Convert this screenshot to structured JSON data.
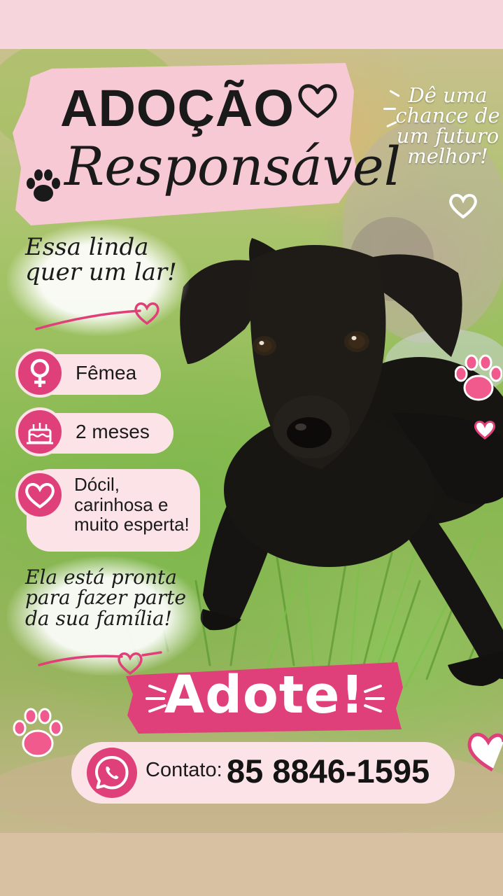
{
  "title": {
    "line1": "ADOÇÃO",
    "line2": "Responsável"
  },
  "tagline": "Dê uma chance de um futuro melhor!",
  "intro_note": {
    "line1": "Essa linda",
    "line2": "quer um lar!"
  },
  "attributes": [
    {
      "icon": "female-icon",
      "label": "Fêmea"
    },
    {
      "icon": "cake-icon",
      "label": "2 meses"
    },
    {
      "icon": "heart-icon",
      "label": "Dócil,\ncarinhosa e\nmuito esperta!"
    }
  ],
  "ready_note": {
    "line1": "Ela está pronta",
    "line2": "para fazer parte",
    "line3": "da sua família!"
  },
  "cta": "Adote!",
  "contact": {
    "icon": "whatsapp-icon",
    "label": "Contato:",
    "phone": "85 8846-1595"
  },
  "colors": {
    "accent_pink": "#e0407a",
    "soft_pink": "#fbe3e8",
    "title_bg_pink": "#f6c9d4",
    "text_dark": "#1a1a1a"
  }
}
